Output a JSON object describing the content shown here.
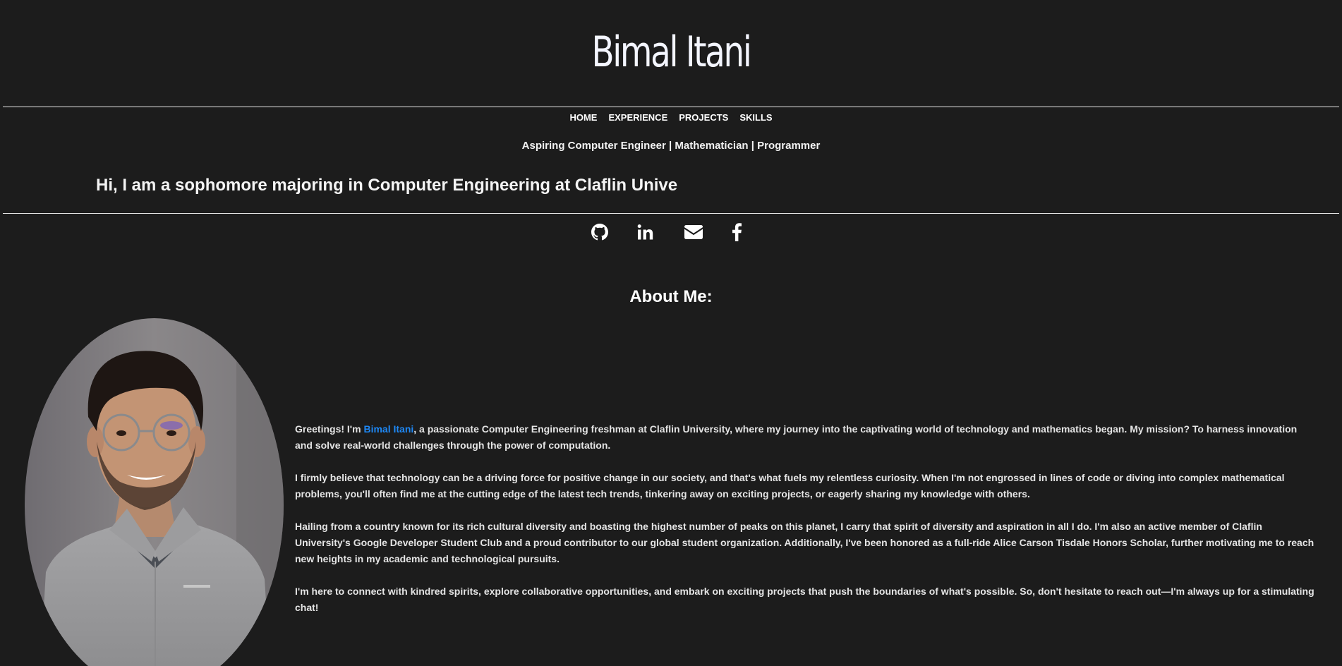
{
  "site": {
    "title": "Bimal Itani",
    "tagline": "Aspiring Computer Engineer | Mathematician | Programmer",
    "intro": "Hi, I am a sophomore majoring in Computer Engineering at Claflin Unive"
  },
  "nav": {
    "items": [
      "HOME",
      "EXPERIENCE",
      "PROJECTS",
      "SKILLS"
    ]
  },
  "socials": [
    {
      "icon": "github-icon"
    },
    {
      "icon": "linkedin-icon"
    },
    {
      "icon": "envelope-icon"
    },
    {
      "icon": "facebook-icon"
    }
  ],
  "about": {
    "heading": "About Me:",
    "p1_before": "Greetings! I'm ",
    "p1_link": "Bimal Itani",
    "p1_after": ", a passionate Computer Engineering freshman at Claflin University, where my journey into the captivating world of technology and mathematics began. My mission? To harness innovation and solve real-world challenges through the power of computation.",
    "p2": "I firmly believe that technology can be a driving force for positive change in our society, and that's what fuels my relentless curiosity. When I'm not engrossed in lines of code or diving into complex mathematical problems, you'll often find me at the cutting edge of the latest tech trends, tinkering away on exciting projects, or eagerly sharing my knowledge with others.",
    "p3": "Hailing from a country known for its rich cultural diversity and boasting the highest number of peaks on this planet, I carry that spirit of diversity and aspiration in all I do. I'm also an active member of Claflin University's Google Developer Student Club and a proud contributor to our global student organization. Additionally, I've been honored as a full-ride Alice Carson Tisdale Honors Scholar, further motivating me to reach new heights in my academic and technological pursuits.",
    "p4": "I'm here to connect with kindred spirits, explore collaborative opportunities, and embark on exciting projects that push the boundaries of what's possible. So, don't hesitate to reach out—I'm always up for a stimulating chat!"
  },
  "colors": {
    "background": "#1c1c1c",
    "text": "#ffffff",
    "link": "#1e88f5"
  }
}
